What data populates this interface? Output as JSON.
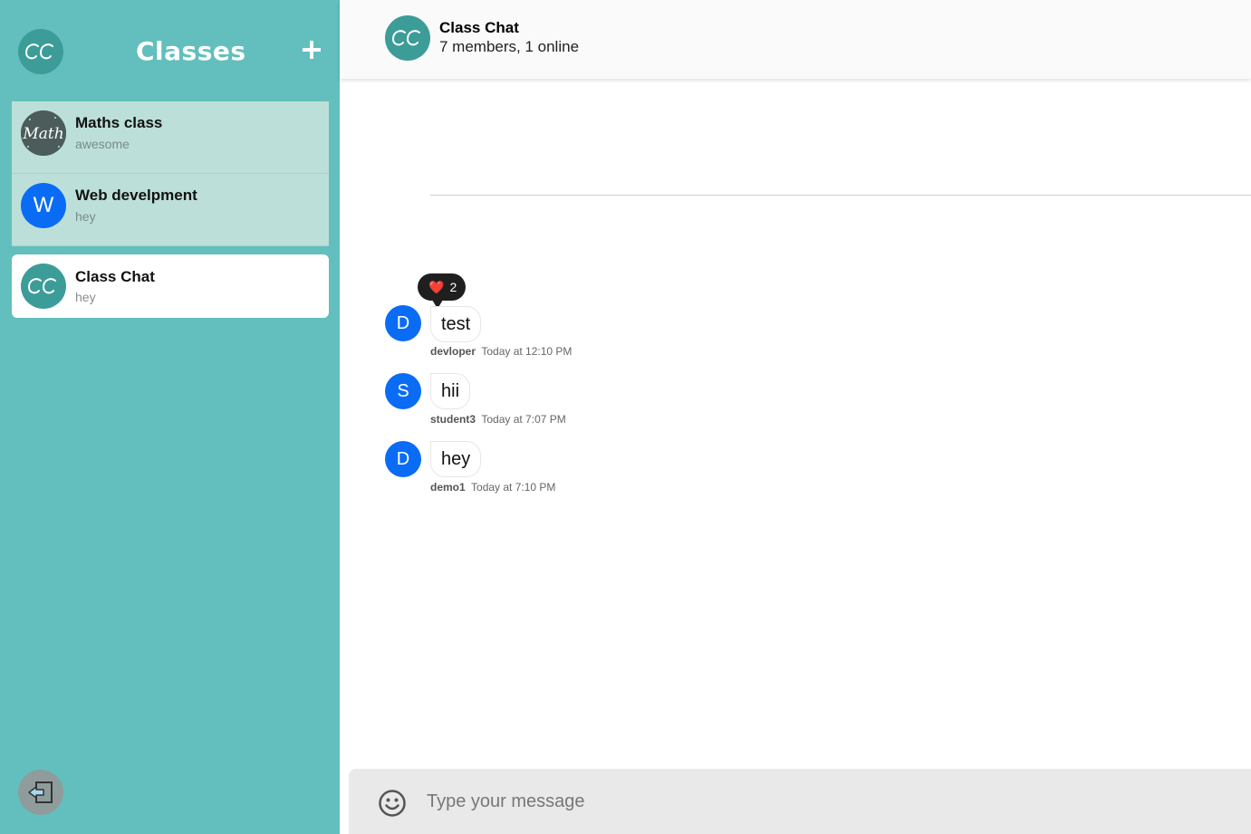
{
  "sidebar": {
    "title": "Classes",
    "logo_text": "CC",
    "add_icon": "plus-icon",
    "logout_icon": "logout-icon",
    "channels": [
      {
        "name": "Maths class",
        "last_message": "awesome",
        "avatar": "math-image"
      },
      {
        "name": "Web develpment",
        "last_message": "hey",
        "avatar_letter": "W"
      },
      {
        "name": "Class Chat",
        "last_message": "hey",
        "avatar": "cc-logo",
        "active": true
      }
    ]
  },
  "header": {
    "title": "Class Chat",
    "subtitle": "7 members, 1 online"
  },
  "messages": [
    {
      "avatar_letter": "D",
      "text": "test",
      "user": "devloper",
      "time": "Today at 12:10 PM",
      "reaction": {
        "emoji": "❤️",
        "count": "2"
      }
    },
    {
      "avatar_letter": "S",
      "text": "hii",
      "user": "student3",
      "time": "Today at 7:07 PM"
    },
    {
      "avatar_letter": "D",
      "text": "hey",
      "user": "demo1",
      "time": "Today at 7:10 PM"
    }
  ],
  "composer": {
    "placeholder": "Type your message",
    "emoji_icon": "smiley-icon"
  },
  "colors": {
    "sidebar_bg": "#62bfbd",
    "channel_bg": "#bce0d9",
    "logo_bg": "#3c9c98",
    "avatar_blue": "#0a6cf5"
  }
}
